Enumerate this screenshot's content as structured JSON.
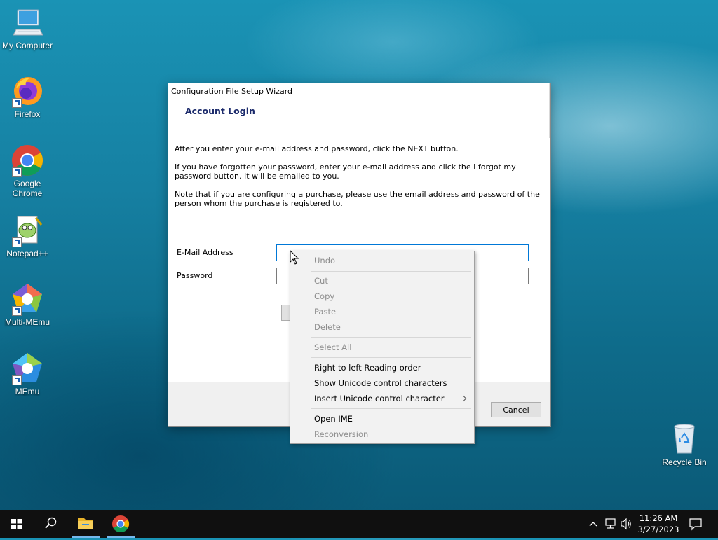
{
  "desktop": {
    "icons": [
      {
        "label": "My Computer",
        "icon": "computer-icon"
      },
      {
        "label": "Firefox",
        "icon": "firefox-icon"
      },
      {
        "label": "Google Chrome",
        "icon": "chrome-icon"
      },
      {
        "label": "Notepad++",
        "icon": "notepadpp-icon"
      },
      {
        "label": "Multi-MEmu",
        "icon": "multi-memu-icon"
      },
      {
        "label": "MEmu",
        "icon": "memu-icon"
      }
    ],
    "recycle_bin": {
      "label": "Recycle Bin",
      "icon": "recycle-bin-icon"
    }
  },
  "wizard": {
    "title": "Configuration File Setup Wizard",
    "heading": "Account Login",
    "paragraphs": [
      "After you enter your e-mail address and password, click the NEXT button.",
      "If you have forgotten your password, enter your e-mail address and click the I forgot my password button. It will be emailed to you.",
      "Note that if you are configuring a purchase, please use the email address and password of the person whom the purchase is registered to."
    ],
    "email_label": "E-Mail Address",
    "email_value": "",
    "password_label": "Password",
    "password_value": "",
    "cancel_label": "Cancel"
  },
  "context_menu": {
    "items": [
      {
        "label": "Undo",
        "enabled": false
      },
      {
        "label": "Cut",
        "enabled": false
      },
      {
        "label": "Copy",
        "enabled": false
      },
      {
        "label": "Paste",
        "enabled": false
      },
      {
        "label": "Delete",
        "enabled": false
      },
      {
        "label": "Select All",
        "enabled": false
      },
      {
        "label": "Right to left Reading order",
        "enabled": true
      },
      {
        "label": "Show Unicode control characters",
        "enabled": true
      },
      {
        "label": "Insert Unicode control character",
        "enabled": true,
        "submenu": true
      },
      {
        "label": "Open IME",
        "enabled": true
      },
      {
        "label": "Reconversion",
        "enabled": false
      }
    ]
  },
  "taskbar": {
    "pinned": [
      {
        "name": "start",
        "icon": "windows-start-icon"
      },
      {
        "name": "search",
        "icon": "search-icon"
      },
      {
        "name": "file-explorer",
        "icon": "folder-icon"
      },
      {
        "name": "chrome",
        "icon": "chrome-icon"
      }
    ],
    "time": "11:26 AM",
    "date": "3/27/2023"
  },
  "colors": {
    "accent": "#0078d7",
    "heading": "#1b2a6b",
    "taskbar": "#101010"
  }
}
